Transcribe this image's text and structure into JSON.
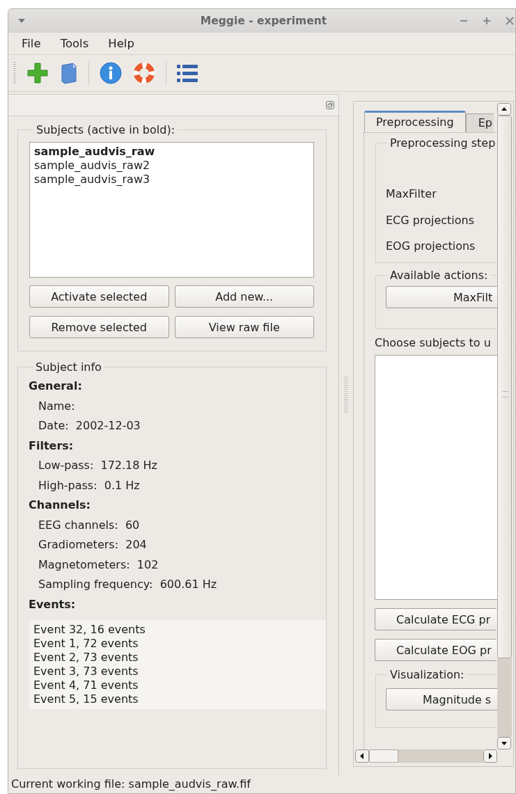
{
  "window": {
    "title": "Meggie - experiment"
  },
  "menu": [
    {
      "label": "File"
    },
    {
      "label": "Tools"
    },
    {
      "label": "Help"
    }
  ],
  "subjects": {
    "title": "Subjects (active in bold):",
    "items": [
      {
        "name": "sample_audvis_raw",
        "active": true
      },
      {
        "name": "sample_audvis_raw2",
        "active": false
      },
      {
        "name": "sample_audvis_raw3",
        "active": false
      }
    ],
    "buttons": [
      "Activate selected",
      "Add new...",
      "Remove selected",
      "View raw file"
    ]
  },
  "subject_info": {
    "title": "Subject info",
    "sections": [
      {
        "heading": "General:",
        "fields": [
          {
            "label": "Name:"
          },
          {
            "label": "Date:",
            "value": "2002-12-03"
          }
        ]
      },
      {
        "heading": "Filters:",
        "fields": [
          {
            "label": "Low-pass:",
            "value": "172.18 Hz"
          },
          {
            "label": "High-pass:",
            "value": "0.1 Hz"
          }
        ]
      },
      {
        "heading": "Channels:",
        "fields": [
          {
            "label": "EEG channels:",
            "value": "60"
          },
          {
            "label": "Gradiometers:",
            "value": "204"
          },
          {
            "label": "Magnetometers:",
            "value": "102"
          },
          {
            "label": "Sampling frequency:",
            "value": "600.61 Hz"
          }
        ]
      },
      {
        "heading": "Events:"
      }
    ],
    "events": [
      "Event 32, 16 events",
      "Event 1, 72 events",
      "Event 2, 73 events",
      "Event 3, 73 events",
      "Event 4, 71 events",
      "Event 5, 15 events"
    ]
  },
  "tabs": [
    {
      "label": "Preprocessing",
      "selected": true
    },
    {
      "label": "Ep",
      "selected": false
    }
  ],
  "preprocessing": {
    "steps_title": "Preprocessing step",
    "steps": [
      "MaxFilter",
      "ECG projections",
      "EOG projections"
    ],
    "actions_title": "Available actions:",
    "action_button": "MaxFilt",
    "choose_label": "Choose subjects to u",
    "calc_buttons": [
      "Calculate ECG pr",
      "Calculate EOG pr"
    ],
    "visualization_title": "Visualization:",
    "visualization_button": "Magnitude s"
  },
  "status_bar": "Current working file: sample_audvis_raw.fif"
}
